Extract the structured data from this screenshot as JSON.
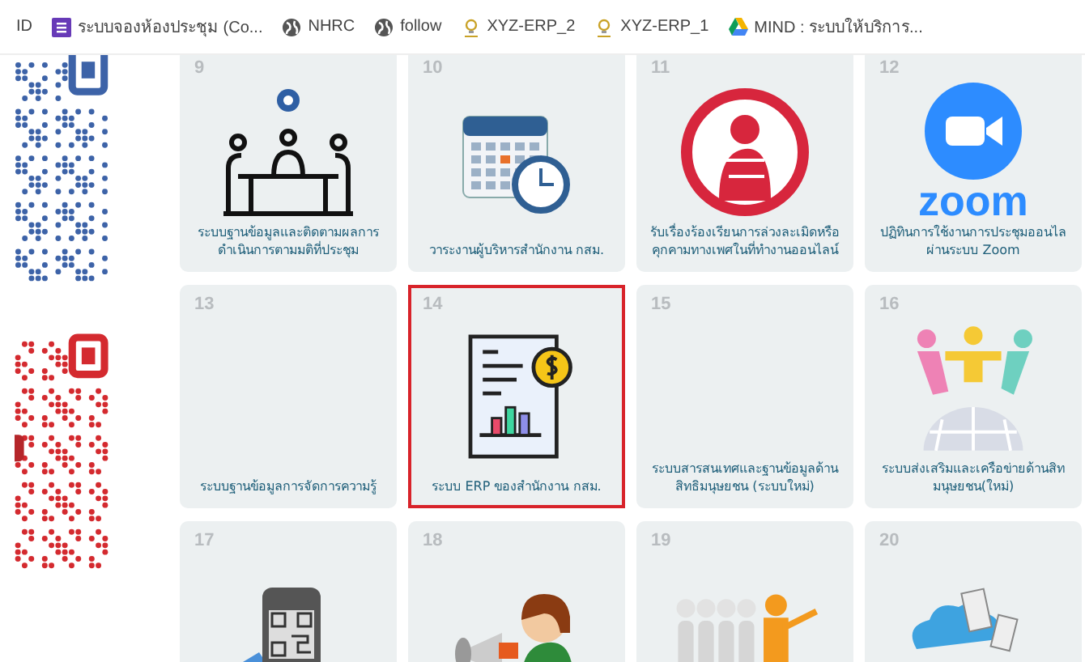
{
  "bookmarks": [
    {
      "kind": "text",
      "label": "ID"
    },
    {
      "kind": "form",
      "label": "ระบบจองห้องประชุม (Co..."
    },
    {
      "kind": "globe",
      "label": "NHRC"
    },
    {
      "kind": "globe",
      "label": "follow"
    },
    {
      "kind": "pin",
      "label": "XYZ-ERP_2"
    },
    {
      "kind": "pin",
      "label": "XYZ-ERP_1"
    },
    {
      "kind": "drive",
      "label": "MIND : ระบบให้บริการ..."
    }
  ],
  "cards": [
    {
      "number": "9",
      "label": "ระบบฐานข้อมูลและติดตามผลการดำเนินการตามมติที่ประชุม",
      "selected": false
    },
    {
      "number": "10",
      "label": "วาระงานผู้บริหารสำนักงาน กสม.",
      "selected": false
    },
    {
      "number": "11",
      "label": "รับเรื่องร้องเรียนการล่วงละเมิดหรือคุกคามทางเพศในที่ทำงานออนไลน์",
      "selected": false
    },
    {
      "number": "12",
      "logo_text": "zoom",
      "label": "ปฏิทินการใช้งานการประชุมออนไล ผ่านระบบ Zoom",
      "selected": false
    },
    {
      "number": "13",
      "label": "ระบบฐานข้อมูลการจัดการความรู้",
      "selected": false
    },
    {
      "number": "14",
      "label": "ระบบ ERP ของสำนักงาน กสม.",
      "selected": true
    },
    {
      "number": "15",
      "label": "ระบบสารสนเทศและฐานข้อมูลด้านสิทธิมนุษยชน (ระบบใหม่)",
      "selected": false
    },
    {
      "number": "16",
      "label": "ระบบส่งเสริมและเครือข่ายด้านสิท มนุษยชน(ใหม่)",
      "selected": false
    },
    {
      "number": "17",
      "selected": false
    },
    {
      "number": "18",
      "selected": false
    },
    {
      "number": "19",
      "selected": false
    },
    {
      "number": "20",
      "selected": false
    }
  ]
}
